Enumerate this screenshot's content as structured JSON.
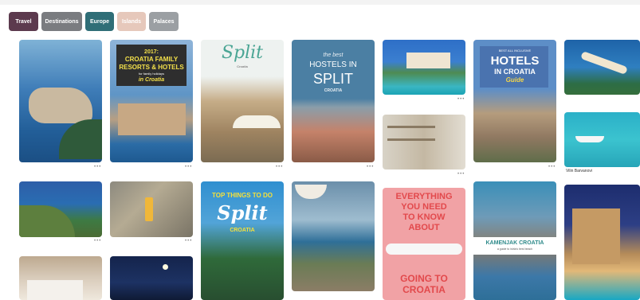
{
  "filters": [
    {
      "label": "Travel"
    },
    {
      "label": "Destinations"
    },
    {
      "label": "Europe"
    },
    {
      "label": "Islands"
    },
    {
      "label": "Palaces"
    }
  ],
  "pins": {
    "p2": {
      "line1": "2017:",
      "line2": "CROATIA FAMILY",
      "line3": "RESORTS & HOTELS",
      "line4": "for family holidays",
      "line5": "in Croatia"
    },
    "p3": {
      "title": "Split",
      "sub": "Croatia"
    },
    "p4": {
      "pre": "the best",
      "line1": "HOSTELS IN",
      "line2": "SPLIT",
      "sub": "CROATIA"
    },
    "p7": {
      "pre": "BEST ALL INCLUSIVE",
      "line1": "HOTELS",
      "line2": "IN CROATIA",
      "line3": "Guide"
    },
    "p9": {
      "caption": "Vilin Barvanovi"
    },
    "p12": {
      "line1": "TOP THINGS TO DO",
      "line2": "Split",
      "line3": "CROATIA"
    },
    "p14": {
      "line1": "EVERYTHING",
      "line2": "YOU NEED",
      "line3": "TO KNOW",
      "line4": "ABOUT",
      "line5": "GOING TO",
      "line6": "CROATIA"
    },
    "p15": {
      "line1": "KAMENJAK CROATIA",
      "line2": "a guide to istria's best beach"
    }
  }
}
